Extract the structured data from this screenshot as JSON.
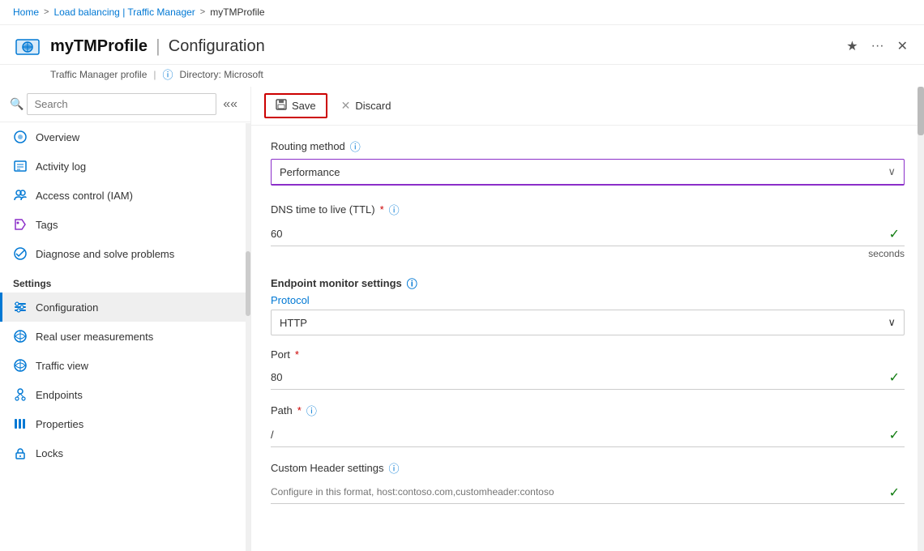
{
  "breadcrumb": {
    "home": "Home",
    "sep1": ">",
    "loadbalancing": "Load balancing | Traffic Manager",
    "sep2": ">",
    "profile": "myTMProfile"
  },
  "header": {
    "resource_name": "myTMProfile",
    "divider": "|",
    "page_title": "Configuration",
    "subtitle": "Traffic Manager profile",
    "directory_label": "Directory: Microsoft",
    "star_icon": "★",
    "more_icon": "···",
    "close_icon": "✕"
  },
  "toolbar": {
    "save_label": "Save",
    "discard_label": "Discard"
  },
  "sidebar": {
    "search_placeholder": "Search",
    "items": [
      {
        "id": "overview",
        "label": "Overview",
        "icon": "globe"
      },
      {
        "id": "activity-log",
        "label": "Activity log",
        "icon": "list"
      },
      {
        "id": "access-control",
        "label": "Access control (IAM)",
        "icon": "people"
      },
      {
        "id": "tags",
        "label": "Tags",
        "icon": "tag"
      },
      {
        "id": "diagnose",
        "label": "Diagnose and solve problems",
        "icon": "wrench"
      }
    ],
    "settings_section": "Settings",
    "settings_items": [
      {
        "id": "configuration",
        "label": "Configuration",
        "icon": "config",
        "active": true
      },
      {
        "id": "real-user",
        "label": "Real user measurements",
        "icon": "globe2"
      },
      {
        "id": "traffic-view",
        "label": "Traffic view",
        "icon": "globe3"
      },
      {
        "id": "endpoints",
        "label": "Endpoints",
        "icon": "endpoint"
      },
      {
        "id": "properties",
        "label": "Properties",
        "icon": "bars"
      },
      {
        "id": "locks",
        "label": "Locks",
        "icon": "lock"
      }
    ]
  },
  "form": {
    "routing_method_label": "Routing method",
    "routing_method_info": "ⓘ",
    "routing_method_value": "Performance",
    "dns_ttl_label": "DNS time to live (TTL)",
    "dns_ttl_required": "*",
    "dns_ttl_info": "ⓘ",
    "dns_ttl_value": "60",
    "dns_ttl_suffix": "seconds",
    "endpoint_monitor_label": "Endpoint monitor settings",
    "endpoint_monitor_info": "ⓘ",
    "protocol_label": "Protocol",
    "protocol_value": "HTTP",
    "port_label": "Port",
    "port_required": "*",
    "port_value": "80",
    "path_label": "Path",
    "path_required": "*",
    "path_info": "ⓘ",
    "path_value": "/",
    "custom_header_label": "Custom Header settings",
    "custom_header_info": "ⓘ",
    "custom_header_placeholder": "Configure in this format, host:contoso.com,customheader:contoso"
  }
}
